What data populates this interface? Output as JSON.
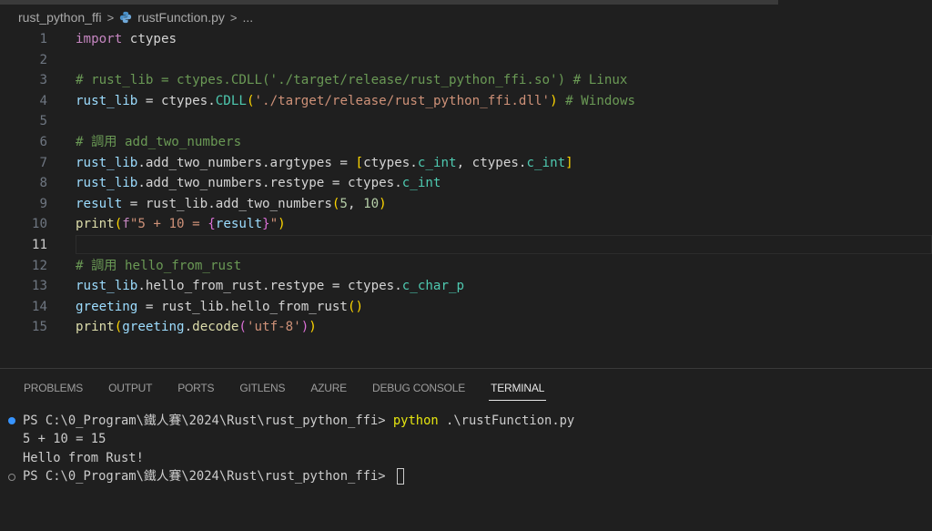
{
  "breadcrumb": {
    "folder": "rust_python_ffi",
    "file": "rustFunction.py",
    "more": "...",
    "separator": ">",
    "file_icon": "python-icon"
  },
  "editor": {
    "active_line": 11,
    "lines": [
      {
        "n": "1",
        "tokens": [
          [
            "kw",
            "import"
          ],
          [
            "plain",
            " ctypes"
          ]
        ]
      },
      {
        "n": "2",
        "tokens": []
      },
      {
        "n": "3",
        "tokens": [
          [
            "cm",
            "# rust_lib = ctypes.CDLL('./target/release/rust_python_ffi.so') # Linux"
          ]
        ]
      },
      {
        "n": "4",
        "tokens": [
          [
            "id",
            "rust_lib"
          ],
          [
            "plain",
            " = ctypes."
          ],
          [
            "cls",
            "CDLL"
          ],
          [
            "br1",
            "("
          ],
          [
            "str",
            "'./target/release/rust_python_ffi.dll'"
          ],
          [
            "br1",
            ")"
          ],
          [
            "cm",
            " # Windows"
          ]
        ]
      },
      {
        "n": "5",
        "tokens": []
      },
      {
        "n": "6",
        "tokens": [
          [
            "cm",
            "# 調用 add_two_numbers"
          ]
        ]
      },
      {
        "n": "7",
        "tokens": [
          [
            "id",
            "rust_lib"
          ],
          [
            "plain",
            ".add_two_numbers.argtypes = "
          ],
          [
            "br1",
            "["
          ],
          [
            "plain",
            "ctypes."
          ],
          [
            "cls",
            "c_int"
          ],
          [
            "plain",
            ", ctypes."
          ],
          [
            "cls",
            "c_int"
          ],
          [
            "br1",
            "]"
          ]
        ]
      },
      {
        "n": "8",
        "tokens": [
          [
            "id",
            "rust_lib"
          ],
          [
            "plain",
            ".add_two_numbers.restype = ctypes."
          ],
          [
            "cls",
            "c_int"
          ]
        ]
      },
      {
        "n": "9",
        "tokens": [
          [
            "id",
            "result"
          ],
          [
            "plain",
            " = rust_lib.add_two_numbers"
          ],
          [
            "br1",
            "("
          ],
          [
            "num",
            "5"
          ],
          [
            "plain",
            ", "
          ],
          [
            "num",
            "10"
          ],
          [
            "br1",
            ")"
          ]
        ]
      },
      {
        "n": "10",
        "tokens": [
          [
            "fn",
            "print"
          ],
          [
            "br1",
            "("
          ],
          [
            "kw",
            "f"
          ],
          [
            "str",
            "\"5 + 10 = "
          ],
          [
            "br2",
            "{"
          ],
          [
            "id",
            "result"
          ],
          [
            "br2",
            "}"
          ],
          [
            "str",
            "\""
          ],
          [
            "br1",
            ")"
          ]
        ]
      },
      {
        "n": "11",
        "tokens": []
      },
      {
        "n": "12",
        "tokens": [
          [
            "cm",
            "# 調用 hello_from_rust"
          ]
        ]
      },
      {
        "n": "13",
        "tokens": [
          [
            "id",
            "rust_lib"
          ],
          [
            "plain",
            ".hello_from_rust.restype = ctypes."
          ],
          [
            "cls",
            "c_char_p"
          ]
        ]
      },
      {
        "n": "14",
        "tokens": [
          [
            "id",
            "greeting"
          ],
          [
            "plain",
            " = rust_lib.hello_from_rust"
          ],
          [
            "br1",
            "()"
          ]
        ]
      },
      {
        "n": "15",
        "tokens": [
          [
            "fn",
            "print"
          ],
          [
            "br1",
            "("
          ],
          [
            "id",
            "greeting"
          ],
          [
            "plain",
            "."
          ],
          [
            "fn",
            "decode"
          ],
          [
            "br2",
            "("
          ],
          [
            "str",
            "'utf-8'"
          ],
          [
            "br2",
            ")"
          ],
          [
            "br1",
            ")"
          ]
        ]
      }
    ]
  },
  "panel": {
    "tabs": [
      "PROBLEMS",
      "OUTPUT",
      "PORTS",
      "GITLENS",
      "AZURE",
      "DEBUG CONSOLE",
      "TERMINAL"
    ],
    "active_tab": "TERMINAL"
  },
  "terminal": {
    "prompt1": "PS C:\\0_Program\\鐵人賽\\2024\\Rust\\rust_python_ffi> ",
    "command": "python",
    "command_args": " .\\rustFunction.py",
    "output1": "5 + 10 = 15",
    "output2": "Hello from Rust!",
    "prompt2": "PS C:\\0_Program\\鐵人賽\\2024\\Rust\\rust_python_ffi> ",
    "accent_dot_color": "#3794ff"
  }
}
